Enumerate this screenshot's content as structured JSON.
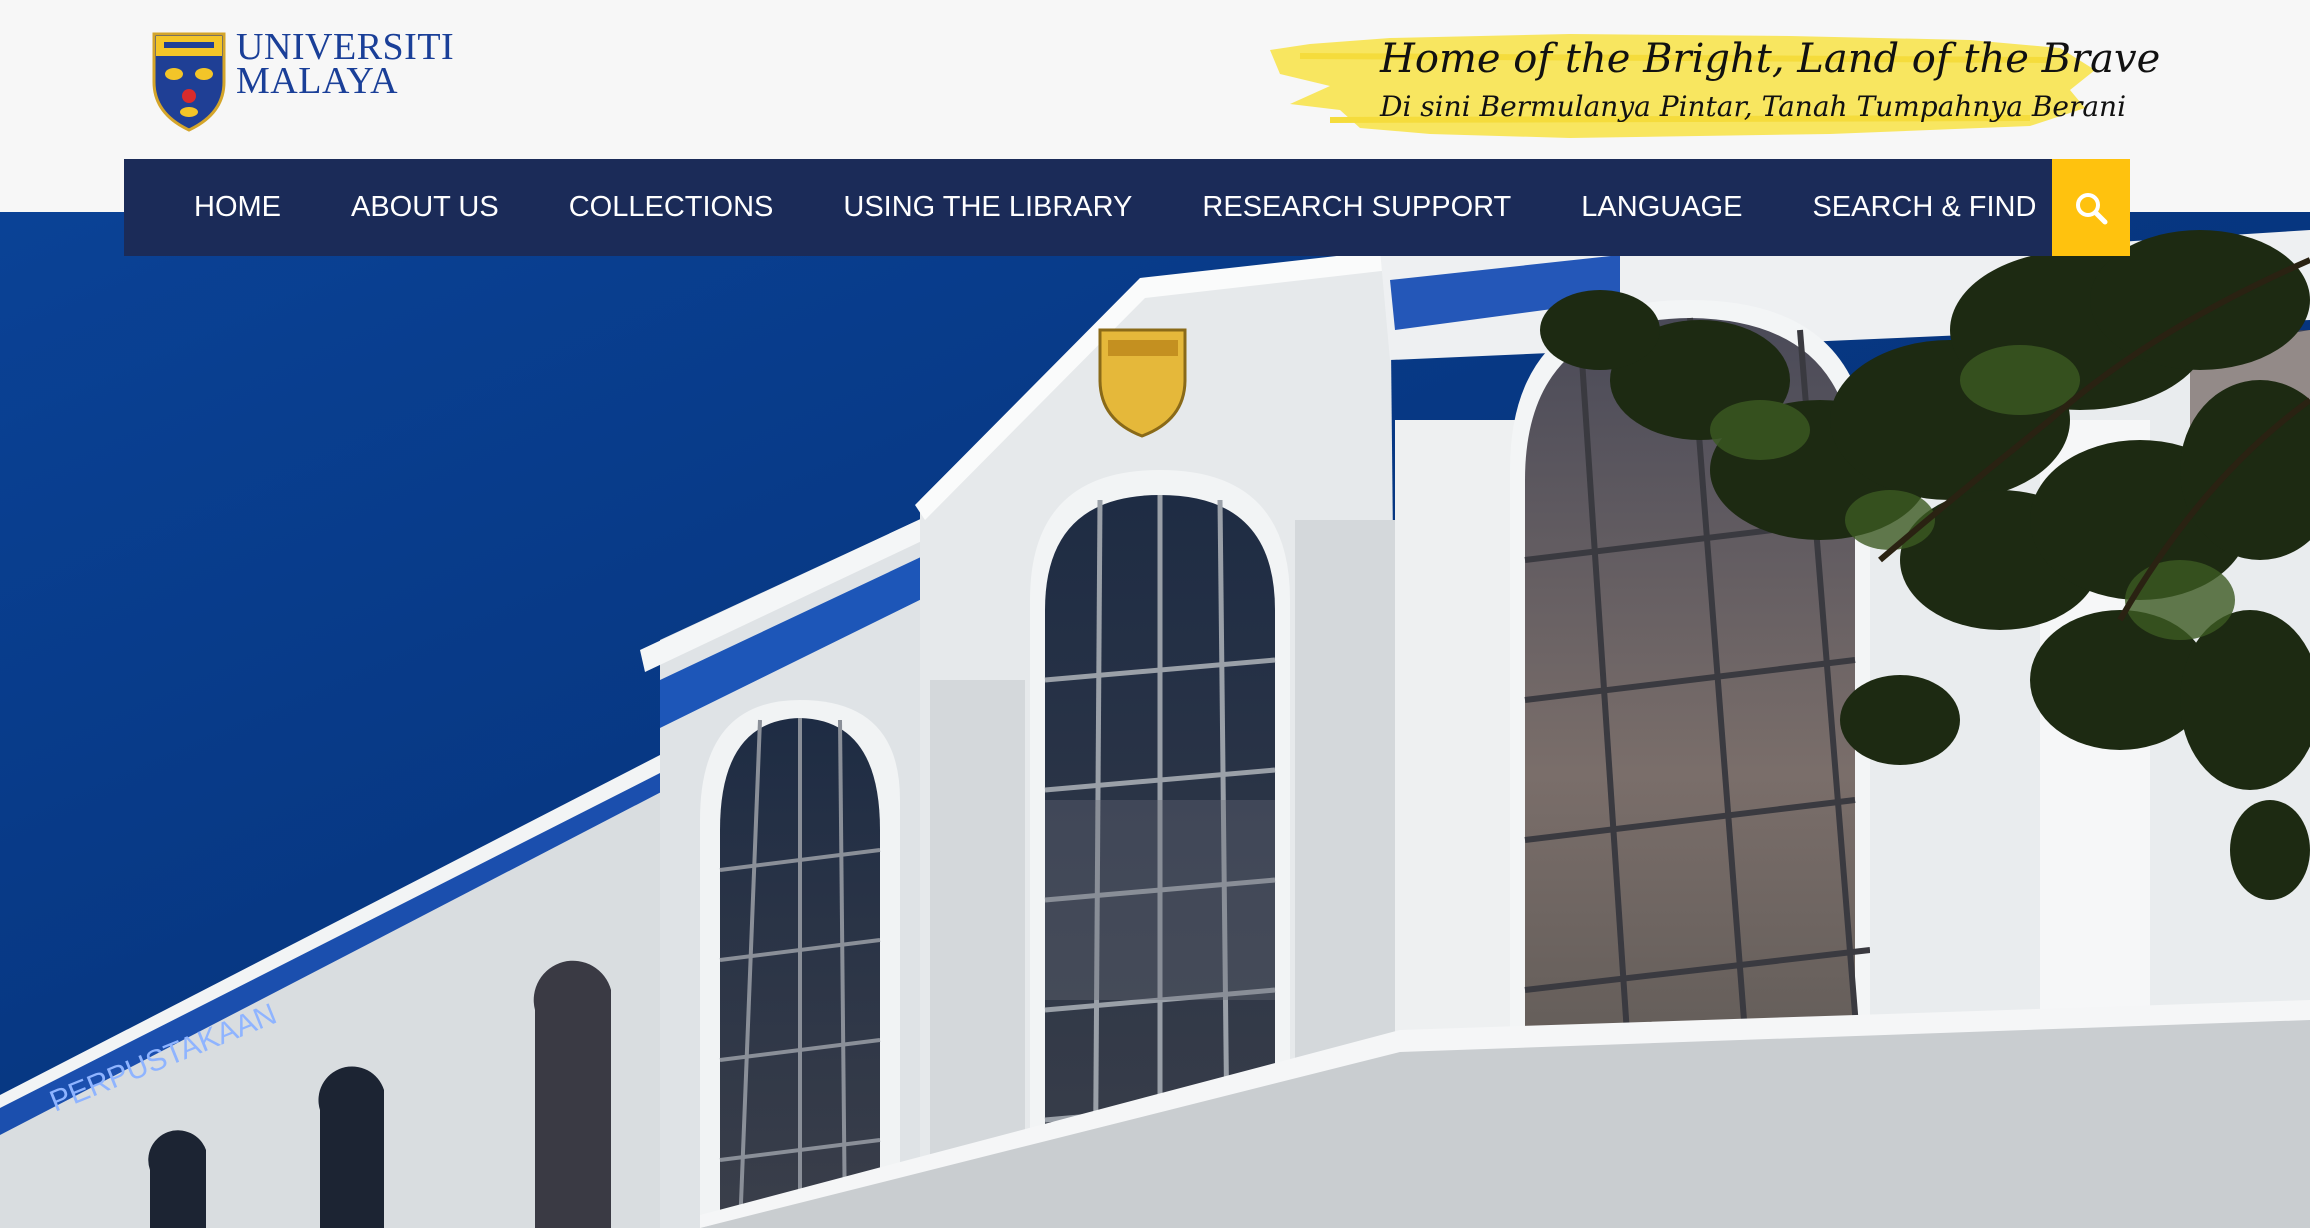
{
  "header": {
    "logo": {
      "line1": "UNIVERSITI",
      "line2": "MALAYA"
    },
    "tagline": {
      "line1": "Home of the Bright, Land of the Brave",
      "line2": "Di sini Bermulanya Pintar, Tanah Tumpahnya Berani"
    }
  },
  "nav": {
    "items": [
      {
        "label": "HOME"
      },
      {
        "label": "ABOUT US"
      },
      {
        "label": "COLLECTIONS"
      },
      {
        "label": "USING THE LIBRARY"
      },
      {
        "label": "RESEARCH SUPPORT"
      },
      {
        "label": "LANGUAGE"
      },
      {
        "label": "SEARCH & FIND"
      }
    ],
    "search_icon": "search-icon"
  },
  "hero": {
    "building_sign": "PERPUSTAKAAN"
  },
  "colors": {
    "nav_bg": "#1b2b58",
    "accent": "#ffc20e",
    "brand_blue": "#1a3f98",
    "sky": "#063a86"
  }
}
